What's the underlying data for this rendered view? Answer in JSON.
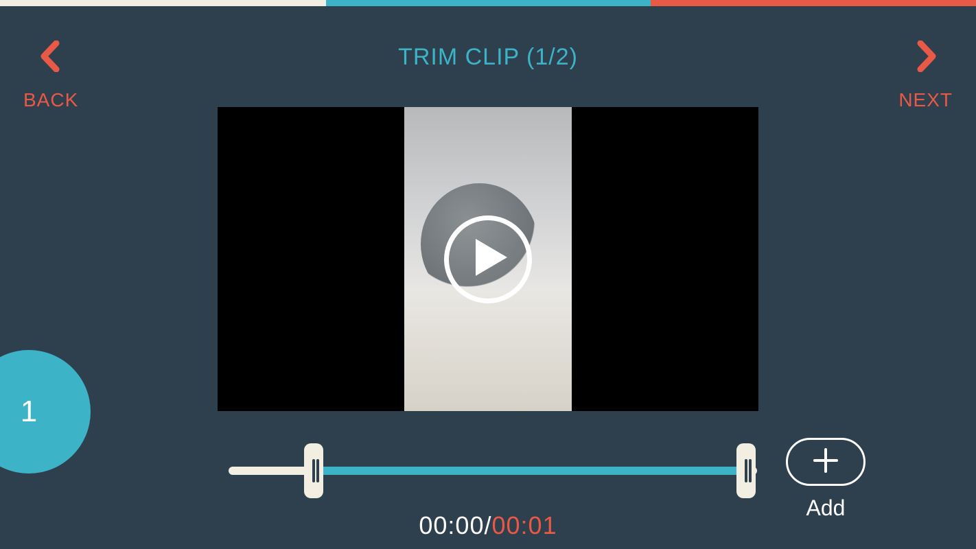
{
  "progress": {
    "segments": 3,
    "active_index": 1
  },
  "nav": {
    "back": {
      "label": "BACK"
    },
    "next": {
      "label": "NEXT"
    }
  },
  "title": "TRIM CLIP (1/2)",
  "clip_badge": "1",
  "trim": {
    "current_time": "00:00",
    "duration": "00:01",
    "separator": "/"
  },
  "add": {
    "label": "Add"
  }
}
